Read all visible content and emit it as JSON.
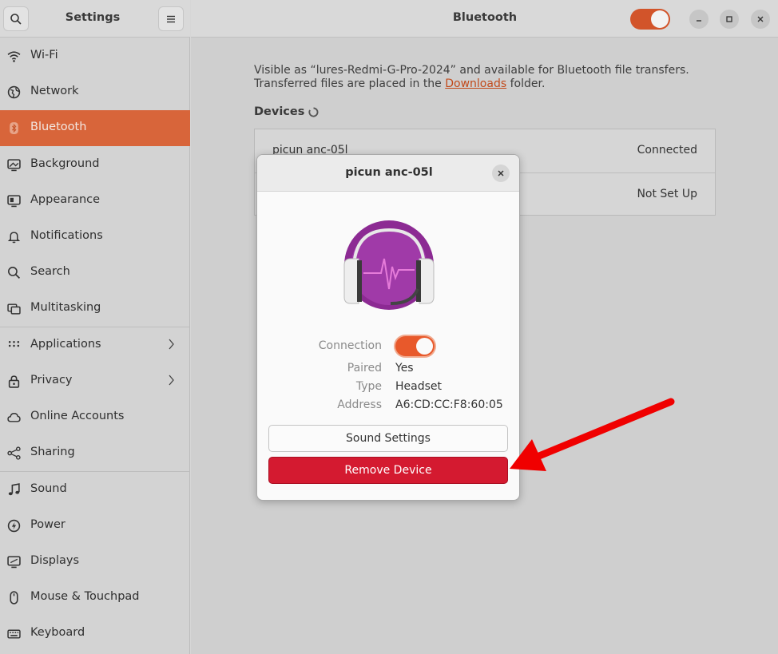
{
  "sidebar": {
    "title": "Settings",
    "items": [
      {
        "label": "Wi-Fi",
        "icon": "wifi-icon"
      },
      {
        "label": "Network",
        "icon": "network-icon"
      },
      {
        "label": "Bluetooth",
        "icon": "bluetooth-icon",
        "active": true
      },
      {
        "label": "Background",
        "icon": "background-icon"
      },
      {
        "label": "Appearance",
        "icon": "appearance-icon"
      },
      {
        "label": "Notifications",
        "icon": "bell-icon"
      },
      {
        "label": "Search",
        "icon": "search-icon"
      },
      {
        "label": "Multitasking",
        "icon": "multitasking-icon"
      },
      {
        "label": "Applications",
        "icon": "apps-grid-icon"
      },
      {
        "label": "Privacy",
        "icon": "lock-icon"
      },
      {
        "label": "Online Accounts",
        "icon": "cloud-icon"
      },
      {
        "label": "Sharing",
        "icon": "share-icon"
      },
      {
        "label": "Sound",
        "icon": "music-note-icon"
      },
      {
        "label": "Power",
        "icon": "power-icon"
      },
      {
        "label": "Displays",
        "icon": "display-icon"
      },
      {
        "label": "Mouse & Touchpad",
        "icon": "mouse-icon"
      },
      {
        "label": "Keyboard",
        "icon": "keyboard-icon"
      }
    ]
  },
  "header": {
    "title": "Bluetooth",
    "bluetooth_enabled": true
  },
  "main": {
    "visible_prefix": "Visible as “lures-Redmi-G-Pro-2024” and available for Bluetooth file transfers.",
    "transfer_prefix": "Transferred files are placed in the ",
    "transfer_link": "Downloads",
    "transfer_suffix": " folder.",
    "devices_title": "Devices",
    "devices": [
      {
        "name": "picun anc-05l",
        "status": "Connected"
      },
      {
        "name": "",
        "status": "Not Set Up"
      }
    ]
  },
  "dialog": {
    "title": "picun anc-05l",
    "connection_label": "Connection",
    "connection_on": true,
    "paired_label": "Paired",
    "paired_value": "Yes",
    "type_label": "Type",
    "type_value": "Headset",
    "address_label": "Address",
    "address_value": "A6:CD:CC:F8:60:05",
    "sound_settings_label": "Sound Settings",
    "remove_device_label": "Remove Device"
  },
  "colors": {
    "accent": "#d8653a",
    "destructive": "#d41a30",
    "annotation_arrow": "#f00000"
  }
}
